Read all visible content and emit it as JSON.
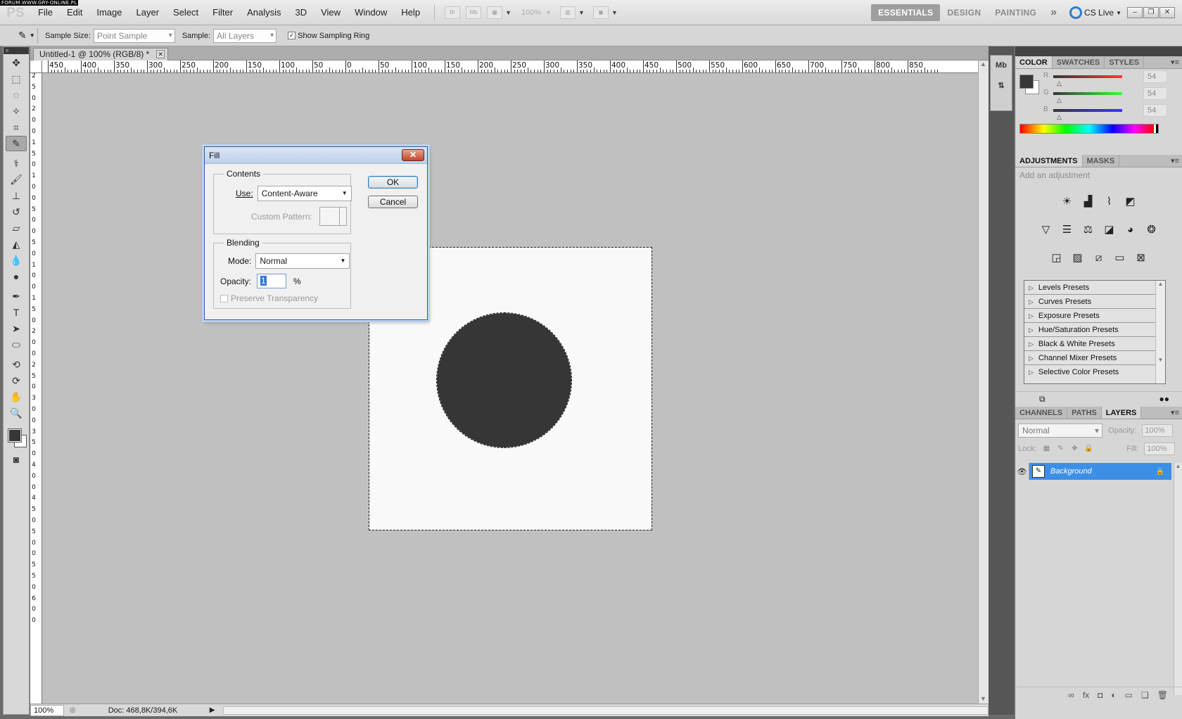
{
  "watermark": "FORUM.WWW.GRY-ONLINE.PL",
  "app": {
    "logo": "PS",
    "menu": [
      "File",
      "Edit",
      "Image",
      "Layer",
      "Select",
      "Filter",
      "Analysis",
      "3D",
      "View",
      "Window",
      "Help"
    ],
    "bridge_label": "Br",
    "minibridge_label": "Mb",
    "zoom_level": "100%",
    "workspaces": [
      "ESSENTIALS",
      "DESIGN",
      "PAINTING"
    ],
    "active_workspace": "ESSENTIALS",
    "more": "»",
    "cs_live": "CS Live"
  },
  "options": {
    "sample_size_label": "Sample Size:",
    "sample_size_value": "Point Sample",
    "sample_label": "Sample:",
    "sample_value": "All Layers",
    "show_ring_label": "Show Sampling Ring",
    "show_ring_checked": true
  },
  "document": {
    "tab_title": "Untitled-1 @ 100% (RGB/8) *",
    "canvas_color": "#f9f9f9",
    "shape_color": "#363636",
    "ruler_top": [
      "450",
      "400",
      "350",
      "300",
      "250",
      "200",
      "150",
      "100",
      "50",
      "0",
      "50",
      "100",
      "150",
      "200",
      "250",
      "300",
      "350",
      "400",
      "450",
      "500",
      "550",
      "600",
      "650",
      "700",
      "750",
      "800",
      "850"
    ],
    "ruler_left": [
      "2",
      "5",
      "0",
      "2",
      "0",
      "0",
      "1",
      "5",
      "0",
      "1",
      "0",
      "0",
      "5",
      "0",
      "0",
      "5",
      "0",
      "1",
      "0",
      "0",
      "1",
      "5",
      "0",
      "2",
      "0",
      "0",
      "2",
      "5",
      "0",
      "3",
      "0",
      "0",
      "3",
      "5",
      "0",
      "4",
      "0",
      "0",
      "4",
      "5",
      "0",
      "5",
      "0",
      "0",
      "5",
      "5",
      "0",
      "6",
      "0",
      "0"
    ]
  },
  "status": {
    "zoom": "100%",
    "doc_size": "Doc: 468,8K/394,6K"
  },
  "fill_dialog": {
    "title": "Fill",
    "contents_legend": "Contents",
    "use_label": "Use:",
    "use_value": "Content-Aware",
    "custom_pattern_label": "Custom Pattern:",
    "blending_legend": "Blending",
    "mode_label": "Mode:",
    "mode_value": "Normal",
    "opacity_label": "Opacity:",
    "opacity_value": "1",
    "opacity_unit": "%",
    "preserve_label": "Preserve  Transparency",
    "ok_label": "OK",
    "cancel_label": "Cancel"
  },
  "color_panel": {
    "tabs": [
      "COLOR",
      "SWATCHES",
      "STYLES"
    ],
    "active_tab": "COLOR",
    "channels": [
      {
        "label": "R",
        "value": "54",
        "gradient": "linear-gradient(90deg,#363636,#ff3636)"
      },
      {
        "label": "G",
        "value": "54",
        "gradient": "linear-gradient(90deg,#363636,#36ff36)"
      },
      {
        "label": "B",
        "value": "54",
        "gradient": "linear-gradient(90deg,#363636,#3636ff)"
      }
    ]
  },
  "adjustments_panel": {
    "tabs": [
      "ADJUSTMENTS",
      "MASKS"
    ],
    "active_tab": "ADJUSTMENTS",
    "subtitle": "Add an adjustment",
    "presets": [
      "Levels Presets",
      "Curves Presets",
      "Exposure Presets",
      "Hue/Saturation Presets",
      "Black & White Presets",
      "Channel Mixer Presets",
      "Selective Color Presets"
    ]
  },
  "layers_panel": {
    "tabs": [
      "CHANNELS",
      "PATHS",
      "LAYERS"
    ],
    "active_tab": "LAYERS",
    "blend_mode": "Normal",
    "opacity_label": "Opacity:",
    "opacity_value": "100%",
    "lock_label": "Lock:",
    "fill_label": "Fill:",
    "fill_value": "100%",
    "layer_name": "Background",
    "selection_color": "#3d8ee6"
  }
}
